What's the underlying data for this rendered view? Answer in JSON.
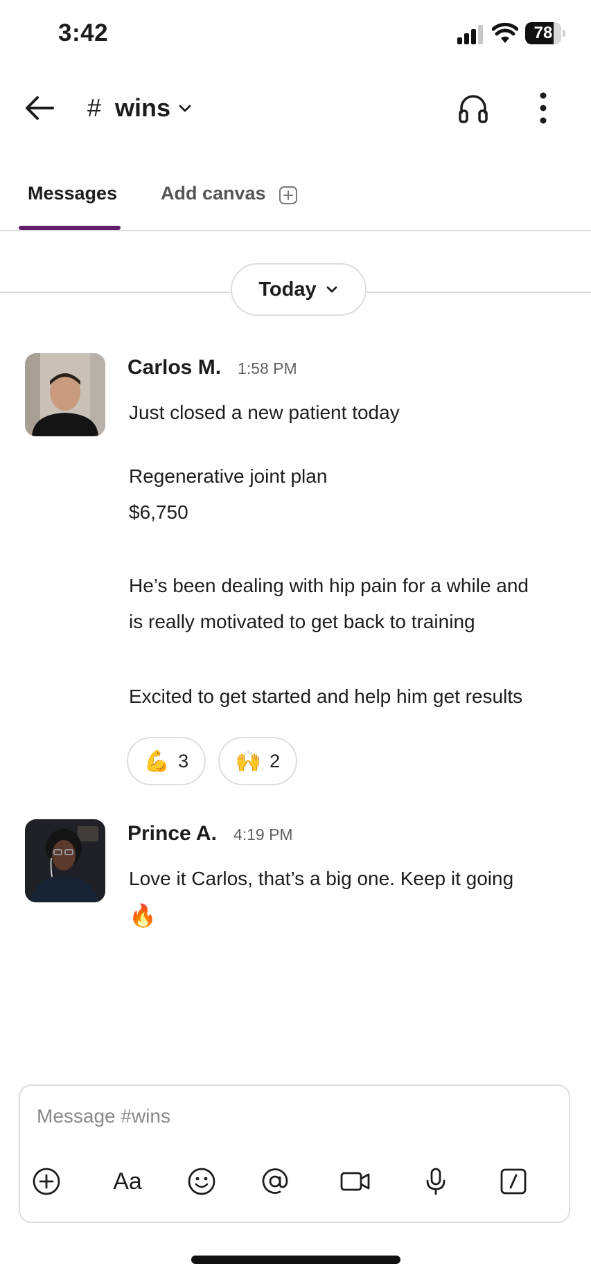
{
  "status_bar": {
    "time": "3:42",
    "battery_level": "78",
    "battery_fraction": 0.78
  },
  "header": {
    "hash": "#",
    "channel_name": "wins"
  },
  "tabs": {
    "messages": "Messages",
    "add_canvas": "Add canvas"
  },
  "date_divider": {
    "label": "Today"
  },
  "messages": [
    {
      "author": "Carlos M.",
      "time": "1:58 PM",
      "lines": [
        "Just closed a new patient today",
        "Regenerative joint plan",
        "$6,750",
        "He’s been dealing with hip pain for a while and",
        "is really motivated to get back to training",
        "Excited to get started and help him get results"
      ],
      "reactions": [
        {
          "emoji": "💪",
          "count": "3"
        },
        {
          "emoji": "🙌",
          "count": "2"
        }
      ]
    },
    {
      "author": "Prince A.",
      "time": "4:19 PM",
      "lines": [
        "Love it Carlos, that’s a big one. Keep it going",
        "🔥"
      ]
    }
  ],
  "composer": {
    "placeholder": "Message #wins",
    "format_label": "Aa",
    "tools": [
      "add-icon",
      "format-text-icon",
      "emoji-icon",
      "mention-icon",
      "video-icon",
      "microphone-icon",
      "slash-command-icon"
    ]
  },
  "colors": {
    "accent": "#611f69",
    "divider": "#dddddd",
    "text": "#1d1c1d",
    "muted": "#616061"
  }
}
